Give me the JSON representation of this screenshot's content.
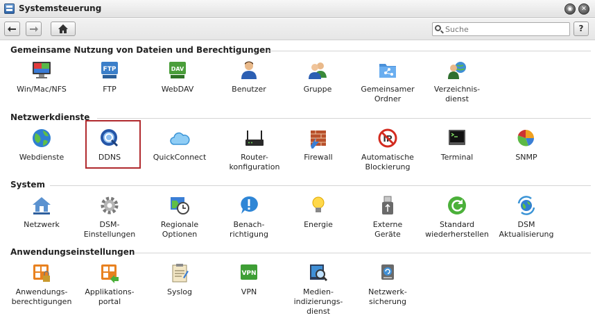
{
  "window": {
    "title": "Systemsteuerung",
    "buttons": [
      "◉",
      "✕"
    ]
  },
  "toolbar": {
    "back_glyph": "🡐",
    "forward_glyph": "🡒",
    "home_glyph": "⌂",
    "help_label": "?",
    "search_placeholder": "Suche"
  },
  "sections": [
    {
      "title": "Gemeinsame Nutzung von Dateien und Berechtigungen",
      "items": [
        {
          "label": "Win/Mac/NFS",
          "icon": "monitor-icon"
        },
        {
          "label": "FTP",
          "icon": "ftp-icon"
        },
        {
          "label": "WebDAV",
          "icon": "webdav-icon"
        },
        {
          "label": "Benutzer",
          "icon": "user-icon"
        },
        {
          "label": "Gruppe",
          "icon": "group-icon"
        },
        {
          "label": "Gemeinsamer\nOrdner",
          "icon": "shared-folder-icon"
        },
        {
          "label": "Verzeichnis-\ndienst",
          "icon": "directory-icon"
        }
      ]
    },
    {
      "title": "Netzwerkdienste",
      "items": [
        {
          "label": "Webdienste",
          "icon": "globe-icon"
        },
        {
          "label": "DDNS",
          "icon": "ddns-icon"
        },
        {
          "label": "QuickConnect",
          "icon": "cloud-icon"
        },
        {
          "label": "Router-\nkonfiguration",
          "icon": "router-icon"
        },
        {
          "label": "Firewall",
          "icon": "firewall-icon"
        },
        {
          "label": "Automatische\nBlockierung",
          "icon": "block-icon"
        },
        {
          "label": "Terminal",
          "icon": "terminal-icon"
        },
        {
          "label": "SNMP",
          "icon": "snmp-icon"
        }
      ]
    },
    {
      "title": "System",
      "items": [
        {
          "label": "Netzwerk",
          "icon": "network-home-icon"
        },
        {
          "label": "DSM-\nEinstellungen",
          "icon": "gear-icon"
        },
        {
          "label": "Regionale\nOptionen",
          "icon": "clock-icon"
        },
        {
          "label": "Benach-\nrichtigung",
          "icon": "notification-icon"
        },
        {
          "label": "Energie",
          "icon": "bulb-icon"
        },
        {
          "label": "Externe\nGeräte",
          "icon": "usb-icon"
        },
        {
          "label": "Standard\nwiederherstellen",
          "icon": "restore-icon"
        },
        {
          "label": "DSM\nAktualisierung",
          "icon": "update-icon"
        }
      ]
    },
    {
      "title": "Anwendungseinstellungen",
      "items": [
        {
          "label": "Anwendungs-\nberechtigungen",
          "icon": "app-privileges-icon"
        },
        {
          "label": "Applikations-\nportal",
          "icon": "app-portal-icon"
        },
        {
          "label": "Syslog",
          "icon": "syslog-icon"
        },
        {
          "label": "VPN",
          "icon": "vpn-icon"
        },
        {
          "label": "Medien-\nindizierungs-\ndienst",
          "icon": "media-index-icon"
        },
        {
          "label": "Netzwerk-\nsicherung",
          "icon": "network-backup-icon"
        }
      ]
    }
  ],
  "selected_item": "DDNS"
}
